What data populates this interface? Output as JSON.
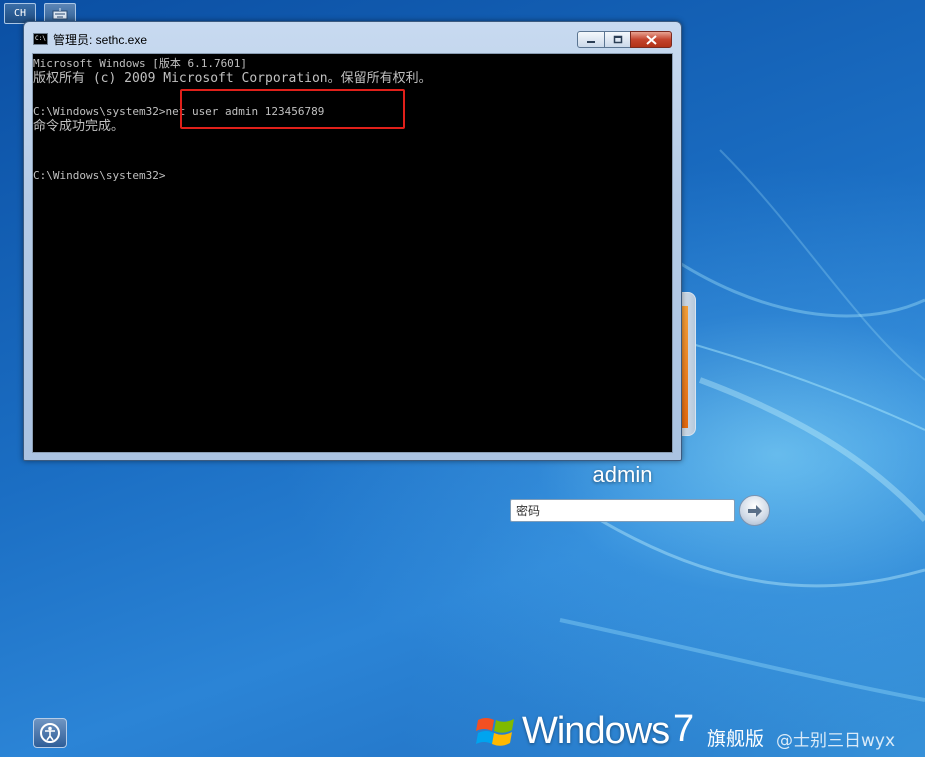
{
  "top_left": {
    "lang_label": "CH",
    "keyboard_icon": "keyboard-icon"
  },
  "cmd": {
    "title": "管理员: sethc.exe",
    "icon": "cmd-icon",
    "controls": {
      "minimize_icon": "minimize-icon",
      "maximize_icon": "maximize-icon",
      "close_icon": "close-icon"
    },
    "lines": [
      "Microsoft Windows [版本 6.1.7601]",
      "版权所有 (c) 2009 Microsoft Corporation。保留所有权利。",
      "",
      "C:\\Windows\\system32>net user admin 123456789",
      "命令成功完成。",
      "",
      "",
      "C:\\Windows\\system32>"
    ]
  },
  "login": {
    "username": "admin",
    "password_placeholder": "密码",
    "submit_icon": "arrow-right-icon"
  },
  "bottom": {
    "ease_of_access_icon": "ease-of-access-icon",
    "brand_name": "Windows",
    "brand_version": "7",
    "brand_edition": "旗舰版",
    "watermark": "@士别三日wyx"
  },
  "colors": {
    "highlight_box": "#e0201a",
    "console_bg": "#000000",
    "console_text": "#c0c0c0"
  }
}
